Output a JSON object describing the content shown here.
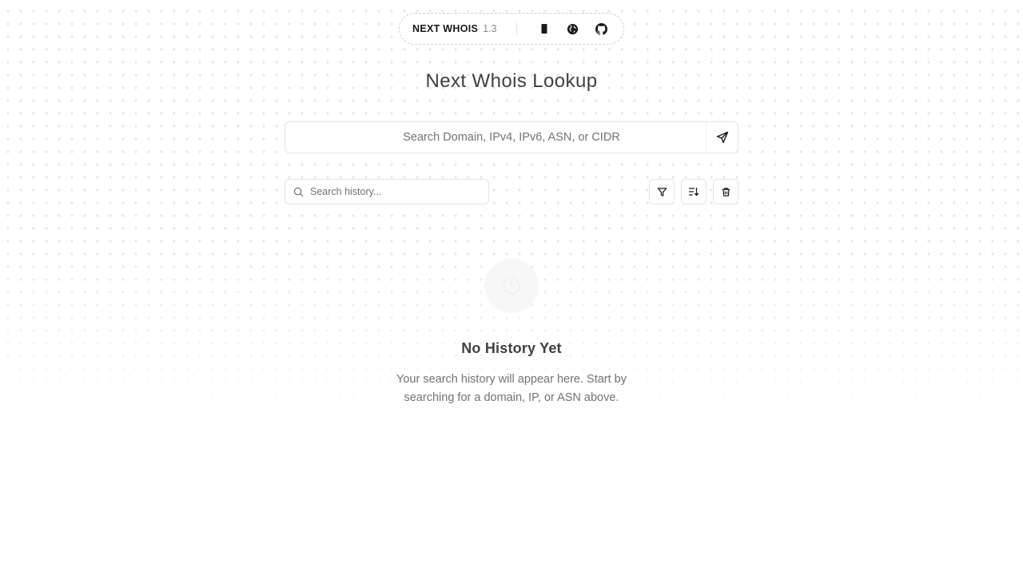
{
  "nav": {
    "brand": "NEXT WHOIS",
    "version": "1.3",
    "icons": [
      "phone-icon",
      "globe-icon",
      "github-icon"
    ]
  },
  "page": {
    "title": "Next Whois Lookup"
  },
  "search": {
    "placeholder": "Search Domain, IPv4, IPv6, ASN, or CIDR",
    "value": ""
  },
  "history": {
    "search_placeholder": "Search history...",
    "empty_title": "No History Yet",
    "empty_description": "Your search history will appear here. Start by searching for a domain, IP, or ASN above."
  },
  "colors": {
    "text": "#18181b",
    "muted": "#71717a",
    "border": "#e4e4e7"
  }
}
